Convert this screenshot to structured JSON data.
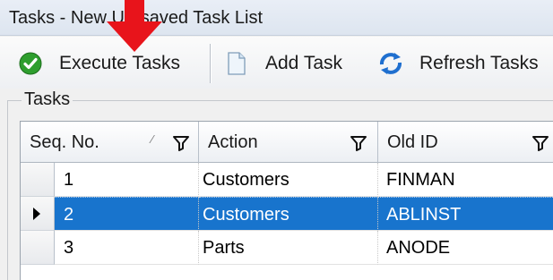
{
  "window": {
    "title": "Tasks - New Un-saved Task List"
  },
  "toolbar": {
    "execute_label": "Execute Tasks",
    "add_label": "Add Task",
    "refresh_label": "Refresh Tasks"
  },
  "group": {
    "label": "Tasks"
  },
  "grid": {
    "columns": [
      "Seq. No.",
      "Action",
      "Old ID"
    ],
    "rows": [
      {
        "seq": "1",
        "action": "Customers",
        "old_id": "FINMAN"
      },
      {
        "seq": "2",
        "action": "Customers",
        "old_id": "ABLINST",
        "selected": true
      },
      {
        "seq": "3",
        "action": "Parts",
        "old_id": "ANODE"
      }
    ]
  },
  "colors": {
    "selection": "#1874cd",
    "annotation_arrow": "#e8141b"
  }
}
